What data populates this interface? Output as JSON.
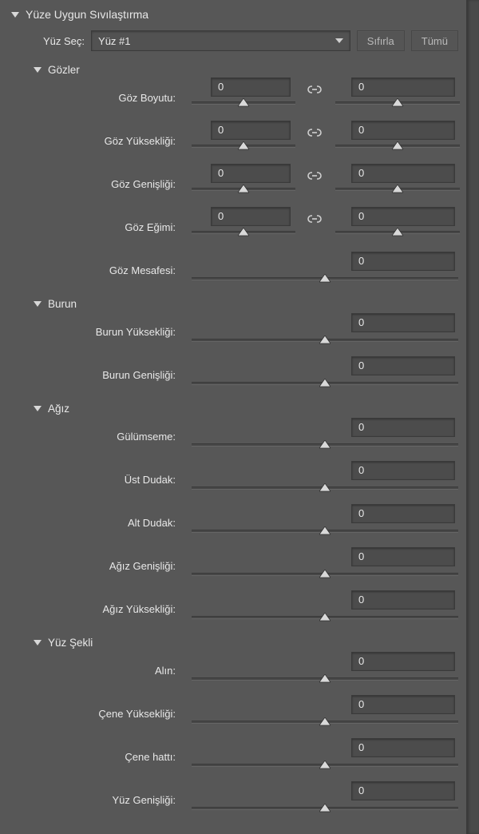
{
  "panel": {
    "title": "Yüze Uygun Sıvılaştırma",
    "faceSelectLabel": "Yüz Seç:",
    "faceSelectValue": "Yüz #1",
    "resetBtn": "Sıfırla",
    "allBtn": "Tümü"
  },
  "groups": {
    "eyes": {
      "title": "Gözler",
      "rows": {
        "size": {
          "label": "Göz Boyutu:",
          "left": "0",
          "right": "0"
        },
        "height": {
          "label": "Göz Yüksekliği:",
          "left": "0",
          "right": "0"
        },
        "width": {
          "label": "Göz Genişliği:",
          "left": "0",
          "right": "0"
        },
        "tilt": {
          "label": "Göz Eğimi:",
          "left": "0",
          "right": "0"
        },
        "distance": {
          "label": "Göz Mesafesi:",
          "value": "0"
        }
      }
    },
    "nose": {
      "title": "Burun",
      "rows": {
        "height": {
          "label": "Burun Yüksekliği:",
          "value": "0"
        },
        "width": {
          "label": "Burun Genişliği:",
          "value": "0"
        }
      }
    },
    "mouth": {
      "title": "Ağız",
      "rows": {
        "smile": {
          "label": "Gülümseme:",
          "value": "0"
        },
        "upper": {
          "label": "Üst Dudak:",
          "value": "0"
        },
        "lower": {
          "label": "Alt Dudak:",
          "value": "0"
        },
        "width": {
          "label": "Ağız Genişliği:",
          "value": "0"
        },
        "height": {
          "label": "Ağız Yüksekliği:",
          "value": "0"
        }
      }
    },
    "faceShape": {
      "title": "Yüz Şekli",
      "rows": {
        "forehead": {
          "label": "Alın:",
          "value": "0"
        },
        "chinH": {
          "label": "Çene Yüksekliği:",
          "value": "0"
        },
        "jawline": {
          "label": "Çene hattı:",
          "value": "0"
        },
        "faceW": {
          "label": "Yüz Genişliği:",
          "value": "0"
        }
      }
    }
  }
}
